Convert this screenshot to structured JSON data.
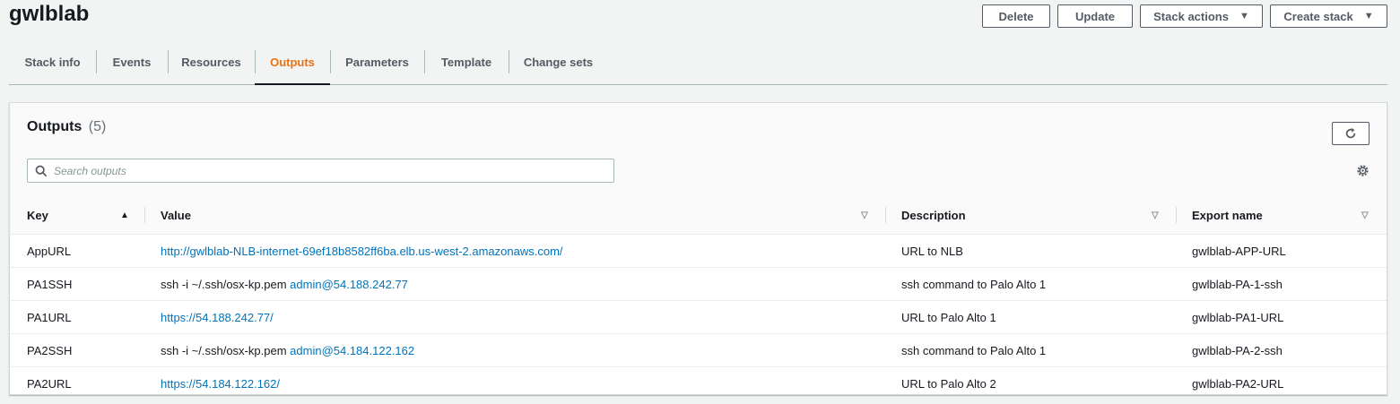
{
  "stack": {
    "name": "gwlblab"
  },
  "actions": {
    "delete": "Delete",
    "update": "Update",
    "stack_actions": "Stack actions",
    "create_stack": "Create stack"
  },
  "tabs": [
    {
      "label": "Stack info",
      "active": false
    },
    {
      "label": "Events",
      "active": false
    },
    {
      "label": "Resources",
      "active": false
    },
    {
      "label": "Outputs",
      "active": true
    },
    {
      "label": "Parameters",
      "active": false
    },
    {
      "label": "Template",
      "active": false
    },
    {
      "label": "Change sets",
      "active": false
    }
  ],
  "outputs": {
    "title": "Outputs",
    "count": "(5)",
    "search_placeholder": "Search outputs",
    "columns": {
      "key": "Key",
      "value": "Value",
      "description": "Description",
      "export_name": "Export name"
    },
    "rows": [
      {
        "key": "AppURL",
        "value_text": "",
        "value_link": "http://gwlblab-NLB-internet-69ef18b8582ff6ba.elb.us-west-2.amazonaws.com/",
        "description": "URL to NLB",
        "export_name": "gwlblab-APP-URL"
      },
      {
        "key": "PA1SSH",
        "value_text": "ssh -i ~/.ssh/osx-kp.pem",
        "value_link": "admin@54.188.242.77",
        "description": "ssh command to Palo Alto 1",
        "export_name": "gwlblab-PA-1-ssh"
      },
      {
        "key": "PA1URL",
        "value_text": "",
        "value_link": "https://54.188.242.77/",
        "description": "URL to Palo Alto 1",
        "export_name": "gwlblab-PA1-URL"
      },
      {
        "key": "PA2SSH",
        "value_text": "ssh -i ~/.ssh/osx-kp.pem",
        "value_link": "admin@54.184.122.162",
        "description": "ssh command to Palo Alto 1",
        "export_name": "gwlblab-PA-2-ssh"
      },
      {
        "key": "PA2URL",
        "value_text": "",
        "value_link": "https://54.184.122.162/",
        "description": "URL to Palo Alto 2",
        "export_name": "gwlblab-PA2-URL"
      }
    ]
  },
  "colors": {
    "accent": "#ec7211",
    "link": "#0073bb",
    "background": "#f2f3f3"
  },
  "icons": {
    "refresh": "refresh-icon",
    "search": "search-icon",
    "settings": "gear-icon",
    "dropdown": "caret-down-icon",
    "sort_asc": "sort-ascending-icon",
    "sort": "sort-icon"
  }
}
